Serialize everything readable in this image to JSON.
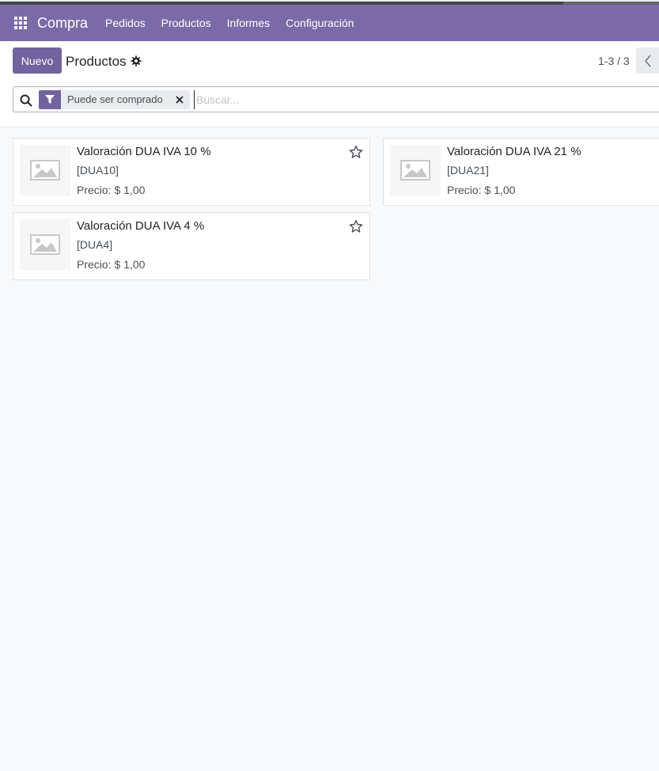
{
  "navbar": {
    "brand": "Compra",
    "menu": [
      "Pedidos",
      "Productos",
      "Informes",
      "Configuración"
    ]
  },
  "control": {
    "new_button": "Nuevo",
    "title": "Productos",
    "pager": "1-3 / 3"
  },
  "search": {
    "facet_label": "Puede ser comprado",
    "placeholder": "Buscar..."
  },
  "products": [
    {
      "name": "Valoración DUA IVA 10 %",
      "code": "[DUA10]",
      "price": "Precio: $ 1,00"
    },
    {
      "name": "Valoración DUA IVA 21 %",
      "code": "[DUA21]",
      "price": "Precio: $ 1,00"
    },
    {
      "name": "Valoración DUA IVA 4 %",
      "code": "[DUA4]",
      "price": "Precio: $ 1,00"
    }
  ],
  "icons": {
    "apps": "apps-grid-icon",
    "gear": "gear-icon",
    "prev": "chevron-left-icon",
    "search": "search-icon",
    "filter": "filter-icon",
    "close": "close-icon",
    "image": "image-placeholder-icon",
    "star": "star-icon"
  },
  "colors": {
    "navbar": "#7a6ba8",
    "primary": "#71639e",
    "background": "#f8f9fa"
  }
}
